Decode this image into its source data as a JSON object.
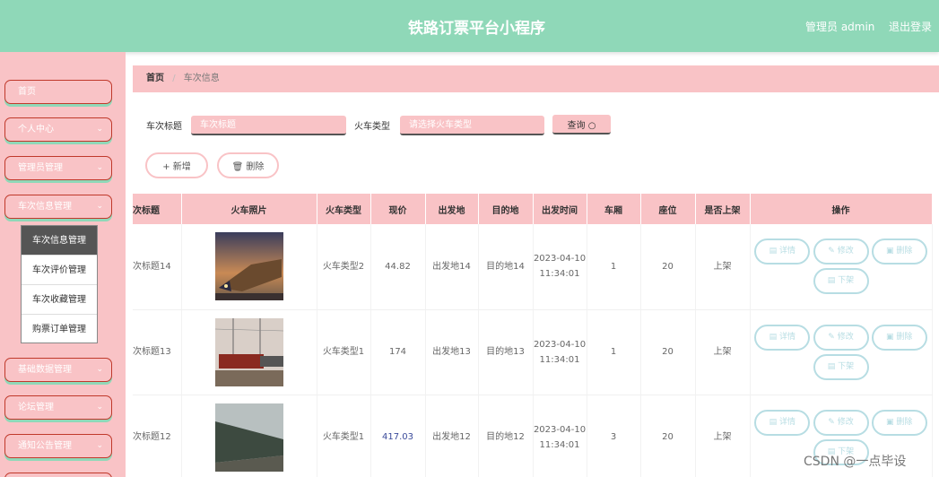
{
  "header": {
    "title": "铁路订票平台小程序",
    "admin": "管理员 admin",
    "logout": "退出登录"
  },
  "sidebar": {
    "items": [
      {
        "label": "首页",
        "has_chevron": false
      },
      {
        "label": "个人中心",
        "has_chevron": true
      },
      {
        "label": "管理员管理",
        "has_chevron": true
      },
      {
        "label": "车次信息管理",
        "has_chevron": true
      },
      {
        "label": "基础数据管理",
        "has_chevron": true
      },
      {
        "label": "论坛管理",
        "has_chevron": true
      },
      {
        "label": "通知公告管理",
        "has_chevron": true
      }
    ],
    "submenu": [
      "车次信息管理",
      "车次评价管理",
      "车次收藏管理",
      "购票订单管理"
    ]
  },
  "breadcrumb": {
    "home": "首页",
    "separator": "/",
    "current": "车次信息"
  },
  "search": {
    "title_label": "车次标题",
    "title_placeholder": "车次标题",
    "type_label": "火车类型",
    "type_placeholder": "请选择火车类型",
    "query_label": "查询 ○"
  },
  "actions": {
    "add": "+ 新增",
    "delete": "🗑 删除"
  },
  "table": {
    "headers": [
      "次标题",
      "火车照片",
      "火车类型",
      "现价",
      "出发地",
      "目的地",
      "出发时间",
      "车厢",
      "座位",
      "是否上架",
      "操作"
    ],
    "rows": [
      {
        "title": "次标题14",
        "type": "火车类型2",
        "price": "44.82",
        "from": "出发地14",
        "to": "目的地14",
        "time": "2023-04-10 11:34:01",
        "carriage": "1",
        "seat": "20",
        "status": "上架"
      },
      {
        "title": "次标题13",
        "type": "火车类型1",
        "price": "174",
        "from": "出发地13",
        "to": "目的地13",
        "time": "2023-04-10 11:34:01",
        "carriage": "1",
        "seat": "20",
        "status": "上架"
      },
      {
        "title": "次标题12",
        "type": "火车类型1",
        "price": "417.03",
        "from": "出发地12",
        "to": "目的地12",
        "time": "2023-04-10 11:34:01",
        "carriage": "3",
        "seat": "20",
        "status": "上架"
      }
    ],
    "row_buttons": {
      "detail": "详情",
      "edit": "修改",
      "delete": "删除",
      "unlist": "下架"
    }
  },
  "watermark": "CSDN @一点毕设",
  "colors": {
    "header": "#8fd8b8",
    "pink": "#f9c3c6",
    "button_border": "#b7dde3"
  }
}
